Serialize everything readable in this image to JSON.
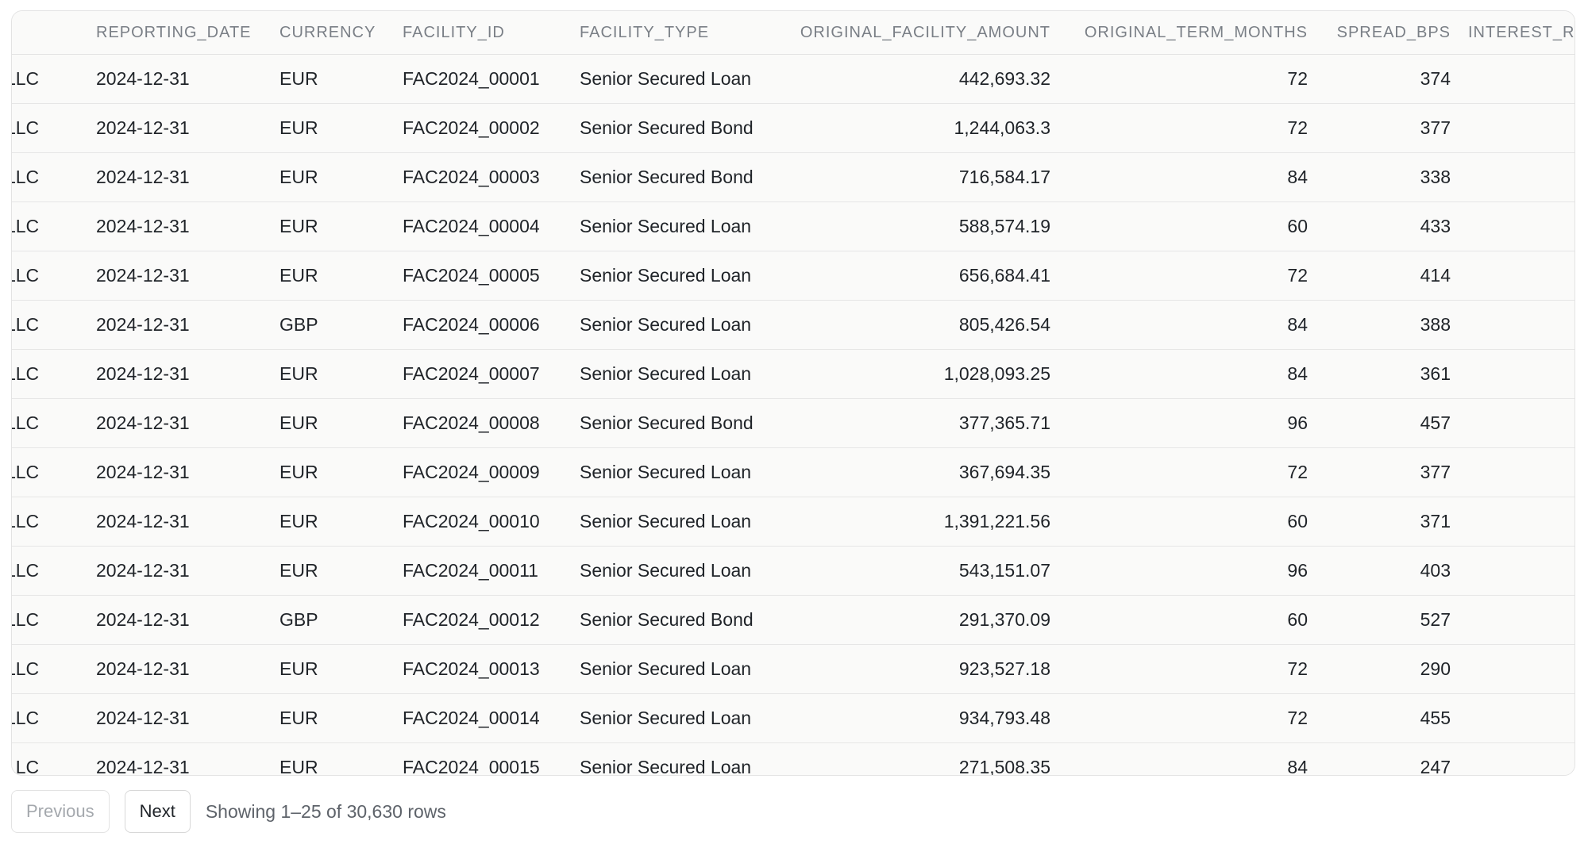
{
  "table": {
    "columns": [
      {
        "key": "lender",
        "label": ""
      },
      {
        "key": "date",
        "label": "REPORTING_DATE"
      },
      {
        "key": "ccy",
        "label": "CURRENCY"
      },
      {
        "key": "fid",
        "label": "FACILITY_ID"
      },
      {
        "key": "ftype",
        "label": "FACILITY_TYPE"
      },
      {
        "key": "amt",
        "label": "ORIGINAL_FACILITY_AMOUNT"
      },
      {
        "key": "term",
        "label": "ORIGINAL_TERM_MONTHS"
      },
      {
        "key": "spread",
        "label": "SPREAD_BPS"
      },
      {
        "key": "rate",
        "label": "INTEREST_R"
      }
    ],
    "rows": [
      {
        "lender": "nt, LLC",
        "date": "2024-12-31",
        "ccy": "EUR",
        "fid": "FAC2024_00001",
        "ftype": "Senior Secured Loan",
        "amt": "442,693.32",
        "term": "72",
        "spread": "374"
      },
      {
        "lender": "nt, LLC",
        "date": "2024-12-31",
        "ccy": "EUR",
        "fid": "FAC2024_00002",
        "ftype": "Senior Secured Bond",
        "amt": "1,244,063.3",
        "term": "72",
        "spread": "377"
      },
      {
        "lender": "nt, LLC",
        "date": "2024-12-31",
        "ccy": "EUR",
        "fid": "FAC2024_00003",
        "ftype": "Senior Secured Bond",
        "amt": "716,584.17",
        "term": "84",
        "spread": "338"
      },
      {
        "lender": "nt, LLC",
        "date": "2024-12-31",
        "ccy": "EUR",
        "fid": "FAC2024_00004",
        "ftype": "Senior Secured Loan",
        "amt": "588,574.19",
        "term": "60",
        "spread": "433"
      },
      {
        "lender": "nt, LLC",
        "date": "2024-12-31",
        "ccy": "EUR",
        "fid": "FAC2024_00005",
        "ftype": "Senior Secured Loan",
        "amt": "656,684.41",
        "term": "72",
        "spread": "414"
      },
      {
        "lender": "nt, LLC",
        "date": "2024-12-31",
        "ccy": "GBP",
        "fid": "FAC2024_00006",
        "ftype": "Senior Secured Loan",
        "amt": "805,426.54",
        "term": "84",
        "spread": "388"
      },
      {
        "lender": "nt, LLC",
        "date": "2024-12-31",
        "ccy": "EUR",
        "fid": "FAC2024_00007",
        "ftype": "Senior Secured Loan",
        "amt": "1,028,093.25",
        "term": "84",
        "spread": "361"
      },
      {
        "lender": "nt, LLC",
        "date": "2024-12-31",
        "ccy": "EUR",
        "fid": "FAC2024_00008",
        "ftype": "Senior Secured Bond",
        "amt": "377,365.71",
        "term": "96",
        "spread": "457"
      },
      {
        "lender": "nt, LLC",
        "date": "2024-12-31",
        "ccy": "EUR",
        "fid": "FAC2024_00009",
        "ftype": "Senior Secured Loan",
        "amt": "367,694.35",
        "term": "72",
        "spread": "377"
      },
      {
        "lender": "nt, LLC",
        "date": "2024-12-31",
        "ccy": "EUR",
        "fid": "FAC2024_00010",
        "ftype": "Senior Secured Loan",
        "amt": "1,391,221.56",
        "term": "60",
        "spread": "371"
      },
      {
        "lender": "nt, LLC",
        "date": "2024-12-31",
        "ccy": "EUR",
        "fid": "FAC2024_00011",
        "ftype": "Senior Secured Loan",
        "amt": "543,151.07",
        "term": "96",
        "spread": "403"
      },
      {
        "lender": "nt, LLC",
        "date": "2024-12-31",
        "ccy": "GBP",
        "fid": "FAC2024_00012",
        "ftype": "Senior Secured Bond",
        "amt": "291,370.09",
        "term": "60",
        "spread": "527"
      },
      {
        "lender": "nt, LLC",
        "date": "2024-12-31",
        "ccy": "EUR",
        "fid": "FAC2024_00013",
        "ftype": "Senior Secured Loan",
        "amt": "923,527.18",
        "term": "72",
        "spread": "290"
      },
      {
        "lender": "nt, LLC",
        "date": "2024-12-31",
        "ccy": "EUR",
        "fid": "FAC2024_00014",
        "ftype": "Senior Secured Loan",
        "amt": "934,793.48",
        "term": "72",
        "spread": "455"
      },
      {
        "lender": "nt, LLC",
        "date": "2024-12-31",
        "ccy": "EUR",
        "fid": "FAC2024_00015",
        "ftype": "Senior Secured Loan",
        "amt": "271,508.35",
        "term": "84",
        "spread": "247"
      }
    ]
  },
  "pagination": {
    "previous_label": "Previous",
    "next_label": "Next",
    "status": "Showing 1–25 of 30,630 rows"
  }
}
